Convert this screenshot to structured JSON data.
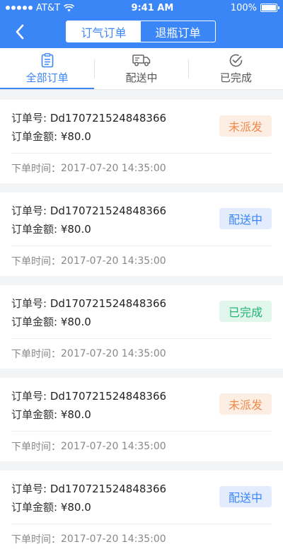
{
  "status_bar": {
    "carrier": "AT&T",
    "time": "9:41 AM",
    "battery": "100%"
  },
  "header": {
    "segments": [
      "订气订单",
      "退瓶订单"
    ],
    "active_segment": 0,
    "colors": {
      "primary": "#3b86f7"
    }
  },
  "tabs": [
    {
      "label": "全部订单",
      "icon": "clipboard-icon",
      "active": true
    },
    {
      "label": "配送中",
      "icon": "delivery-truck-icon",
      "active": false
    },
    {
      "label": "已完成",
      "icon": "check-circle-icon",
      "active": false
    }
  ],
  "orders": [
    {
      "order_no_label": "订单号:",
      "order_no": "Dd170721524848366",
      "amount_label": "订单金额:",
      "amount": "¥80.0",
      "time_label": "下单时间：",
      "time": "2017-07-20 14:35:00",
      "status": "未派发",
      "status_type": "pending"
    },
    {
      "order_no_label": "订单号:",
      "order_no": "Dd170721524848366",
      "amount_label": "订单金额:",
      "amount": "¥80.0",
      "time_label": "下单时间：",
      "time": "2017-07-20 14:35:00",
      "status": "配送中",
      "status_type": "shipping"
    },
    {
      "order_no_label": "订单号:",
      "order_no": "Dd170721524848366",
      "amount_label": "订单金额:",
      "amount": "¥80.0",
      "time_label": "下单时间：",
      "time": "2017-07-20 14:35:00",
      "status": "已完成",
      "status_type": "done"
    },
    {
      "order_no_label": "订单号:",
      "order_no": "Dd170721524848366",
      "amount_label": "订单金额:",
      "amount": "¥80.0",
      "time_label": "下单时间：",
      "time": "2017-07-20 14:35:00",
      "status": "未派发",
      "status_type": "pending"
    },
    {
      "order_no_label": "订单号:",
      "order_no": "Dd170721524848366",
      "amount_label": "订单金额:",
      "amount": "¥80.0",
      "time_label": "下单时间：",
      "time": "2017-07-20 14:35:00",
      "status": "配送中",
      "status_type": "shipping"
    }
  ]
}
